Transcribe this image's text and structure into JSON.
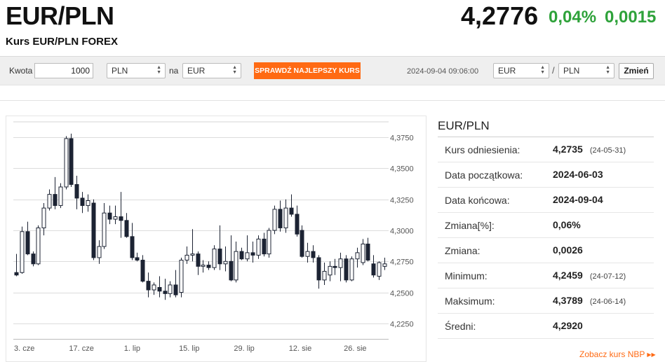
{
  "header": {
    "pair": "EUR/PLN",
    "subtitle": "Kurs EUR/PLN FOREX",
    "price": "4,2776",
    "change_pct": "0,04%",
    "change_abs": "0,0015",
    "positive_color": "#2ea23a"
  },
  "toolbar": {
    "amount_label": "Kwota",
    "amount_value": "1000",
    "from_currency": "PLN",
    "to_label": "na",
    "to_currency": "EUR",
    "best_rate_button": "SPRAWDŹ NAJLEPSZY KURS",
    "timestamp": "2024-09-04 09:06:00",
    "base_select": "EUR",
    "separator": "/",
    "quote_select": "PLN",
    "change_button": "Zmień",
    "accent_color": "#ff6a13"
  },
  "stats": {
    "title": "EUR/PLN",
    "rows": [
      {
        "label": "Kurs odniesienia:",
        "value": "4,2735",
        "sub": "(24-05-31)"
      },
      {
        "label": "Data początkowa:",
        "value": "2024-06-03",
        "sub": ""
      },
      {
        "label": "Data końcowa:",
        "value": "2024-09-04",
        "sub": ""
      },
      {
        "label": "Zmiana[%]:",
        "value": "0,06%",
        "sub": ""
      },
      {
        "label": "Zmiana:",
        "value": "0,0026",
        "sub": ""
      },
      {
        "label": "Minimum:",
        "value": "4,2459",
        "sub": "(24-07-12)"
      },
      {
        "label": "Maksimum:",
        "value": "4,3789",
        "sub": "(24-06-14)"
      },
      {
        "label": "Średni:",
        "value": "4,2920",
        "sub": ""
      }
    ],
    "nbp_link": "Zobacz kurs NBP"
  },
  "chart_data": {
    "type": "candlestick",
    "ylim": [
      4.2125,
      4.3875
    ],
    "y_ticks": [
      4.225,
      4.25,
      4.275,
      4.3,
      4.325,
      4.35,
      4.375
    ],
    "y_tick_labels": [
      "4,2250",
      "4,2500",
      "4,2750",
      "4,3000",
      "4,3250",
      "4,3500",
      "4,3750"
    ],
    "x_tick_labels": [
      "3. cze",
      "17. cze",
      "1. lip",
      "15. lip",
      "29. lip",
      "12. sie",
      "26. sie"
    ],
    "x_tick_index": [
      0,
      10,
      20,
      30,
      40,
      50,
      60
    ],
    "grid": true,
    "up_color": "#ffffff",
    "down_color": "#1c2333",
    "candles": [
      {
        "o": 4.266,
        "h": 4.281,
        "l": 4.263,
        "c": 4.264
      },
      {
        "o": 4.266,
        "h": 4.303,
        "l": 4.265,
        "c": 4.299
      },
      {
        "o": 4.299,
        "h": 4.307,
        "l": 4.28,
        "c": 4.281
      },
      {
        "o": 4.281,
        "h": 4.283,
        "l": 4.271,
        "c": 4.273
      },
      {
        "o": 4.273,
        "h": 4.304,
        "l": 4.272,
        "c": 4.302
      },
      {
        "o": 4.302,
        "h": 4.322,
        "l": 4.296,
        "c": 4.318
      },
      {
        "o": 4.318,
        "h": 4.333,
        "l": 4.316,
        "c": 4.329
      },
      {
        "o": 4.329,
        "h": 4.343,
        "l": 4.317,
        "c": 4.32
      },
      {
        "o": 4.32,
        "h": 4.338,
        "l": 4.318,
        "c": 4.335
      },
      {
        "o": 4.335,
        "h": 4.376,
        "l": 4.333,
        "c": 4.374
      },
      {
        "o": 4.374,
        "h": 4.378,
        "l": 4.335,
        "c": 4.337
      },
      {
        "o": 4.337,
        "h": 4.344,
        "l": 4.317,
        "c": 4.326
      },
      {
        "o": 4.326,
        "h": 4.331,
        "l": 4.314,
        "c": 4.32
      },
      {
        "o": 4.32,
        "h": 4.329,
        "l": 4.315,
        "c": 4.324
      },
      {
        "o": 4.322,
        "h": 4.325,
        "l": 4.276,
        "c": 4.278
      },
      {
        "o": 4.278,
        "h": 4.292,
        "l": 4.273,
        "c": 4.287
      },
      {
        "o": 4.287,
        "h": 4.322,
        "l": 4.285,
        "c": 4.314
      },
      {
        "o": 4.314,
        "h": 4.32,
        "l": 4.305,
        "c": 4.309
      },
      {
        "o": 4.309,
        "h": 4.32,
        "l": 4.305,
        "c": 4.311
      },
      {
        "o": 4.311,
        "h": 4.331,
        "l": 4.294,
        "c": 4.308
      },
      {
        "o": 4.308,
        "h": 4.314,
        "l": 4.294,
        "c": 4.295
      },
      {
        "o": 4.295,
        "h": 4.306,
        "l": 4.276,
        "c": 4.278
      },
      {
        "o": 4.278,
        "h": 4.282,
        "l": 4.275,
        "c": 4.276
      },
      {
        "o": 4.276,
        "h": 4.28,
        "l": 4.258,
        "c": 4.259
      },
      {
        "o": 4.259,
        "h": 4.266,
        "l": 4.246,
        "c": 4.252
      },
      {
        "o": 4.252,
        "h": 4.258,
        "l": 4.248,
        "c": 4.256
      },
      {
        "o": 4.254,
        "h": 4.263,
        "l": 4.246,
        "c": 4.251
      },
      {
        "o": 4.251,
        "h": 4.261,
        "l": 4.244,
        "c": 4.249
      },
      {
        "o": 4.249,
        "h": 4.259,
        "l": 4.246,
        "c": 4.256
      },
      {
        "o": 4.256,
        "h": 4.268,
        "l": 4.246,
        "c": 4.248
      },
      {
        "o": 4.25,
        "h": 4.278,
        "l": 4.246,
        "c": 4.276
      },
      {
        "o": 4.276,
        "h": 4.287,
        "l": 4.273,
        "c": 4.28
      },
      {
        "o": 4.28,
        "h": 4.301,
        "l": 4.275,
        "c": 4.281
      },
      {
        "o": 4.281,
        "h": 4.283,
        "l": 4.264,
        "c": 4.271
      },
      {
        "o": 4.271,
        "h": 4.276,
        "l": 4.266,
        "c": 4.272
      },
      {
        "o": 4.272,
        "h": 4.275,
        "l": 4.268,
        "c": 4.27
      },
      {
        "o": 4.27,
        "h": 4.288,
        "l": 4.268,
        "c": 4.285
      },
      {
        "o": 4.285,
        "h": 4.304,
        "l": 4.268,
        "c": 4.273
      },
      {
        "o": 4.273,
        "h": 4.287,
        "l": 4.267,
        "c": 4.275
      },
      {
        "o": 4.275,
        "h": 4.296,
        "l": 4.259,
        "c": 4.26
      },
      {
        "o": 4.26,
        "h": 4.291,
        "l": 4.258,
        "c": 4.283
      },
      {
        "o": 4.283,
        "h": 4.286,
        "l": 4.276,
        "c": 4.277
      },
      {
        "o": 4.277,
        "h": 4.296,
        "l": 4.275,
        "c": 4.282
      },
      {
        "o": 4.282,
        "h": 4.291,
        "l": 4.274,
        "c": 4.28
      },
      {
        "o": 4.28,
        "h": 4.296,
        "l": 4.277,
        "c": 4.293
      },
      {
        "o": 4.293,
        "h": 4.298,
        "l": 4.279,
        "c": 4.281
      },
      {
        "o": 4.281,
        "h": 4.302,
        "l": 4.278,
        "c": 4.3
      },
      {
        "o": 4.3,
        "h": 4.32,
        "l": 4.297,
        "c": 4.317
      },
      {
        "o": 4.317,
        "h": 4.324,
        "l": 4.299,
        "c": 4.302
      },
      {
        "o": 4.302,
        "h": 4.325,
        "l": 4.298,
        "c": 4.318
      },
      {
        "o": 4.318,
        "h": 4.329,
        "l": 4.311,
        "c": 4.313
      },
      {
        "o": 4.313,
        "h": 4.32,
        "l": 4.295,
        "c": 4.297
      },
      {
        "o": 4.3,
        "h": 4.304,
        "l": 4.278,
        "c": 4.279
      },
      {
        "o": 4.279,
        "h": 4.29,
        "l": 4.274,
        "c": 4.283
      },
      {
        "o": 4.283,
        "h": 4.288,
        "l": 4.274,
        "c": 4.278
      },
      {
        "o": 4.278,
        "h": 4.28,
        "l": 4.253,
        "c": 4.26
      },
      {
        "o": 4.26,
        "h": 4.274,
        "l": 4.256,
        "c": 4.267
      },
      {
        "o": 4.264,
        "h": 4.275,
        "l": 4.259,
        "c": 4.271
      },
      {
        "o": 4.271,
        "h": 4.277,
        "l": 4.264,
        "c": 4.27
      },
      {
        "o": 4.27,
        "h": 4.282,
        "l": 4.259,
        "c": 4.277
      },
      {
        "o": 4.277,
        "h": 4.28,
        "l": 4.258,
        "c": 4.26
      },
      {
        "o": 4.26,
        "h": 4.279,
        "l": 4.259,
        "c": 4.277
      },
      {
        "o": 4.277,
        "h": 4.286,
        "l": 4.27,
        "c": 4.282
      },
      {
        "o": 4.274,
        "h": 4.293,
        "l": 4.272,
        "c": 4.289
      },
      {
        "o": 4.289,
        "h": 4.294,
        "l": 4.275,
        "c": 4.276
      },
      {
        "o": 4.273,
        "h": 4.28,
        "l": 4.262,
        "c": 4.264
      },
      {
        "o": 4.263,
        "h": 4.275,
        "l": 4.26,
        "c": 4.274
      },
      {
        "o": 4.271,
        "h": 4.278,
        "l": 4.268,
        "c": 4.273
      }
    ]
  }
}
